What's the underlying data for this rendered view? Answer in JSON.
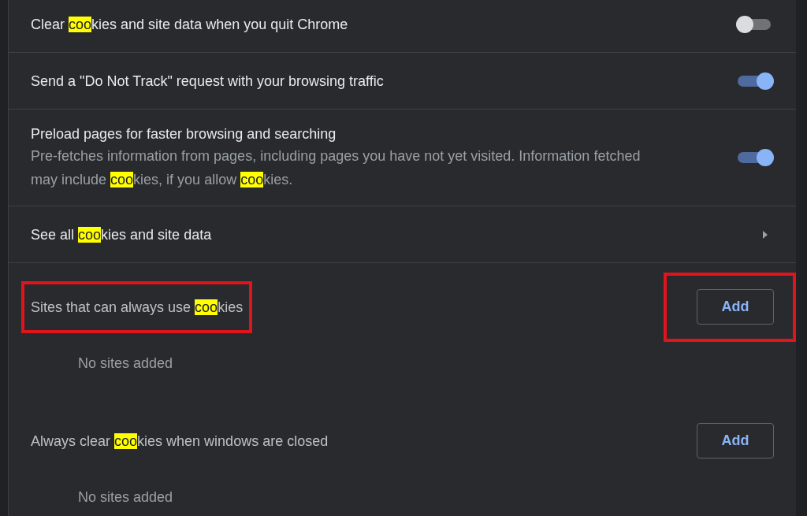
{
  "settings": [
    {
      "kind": "toggle",
      "on": false,
      "title": [
        {
          "text": "Clear ",
          "highlight": false
        },
        {
          "text": "coo",
          "highlight": true
        },
        {
          "text": "kies and site data when you quit Chrome",
          "highlight": false
        }
      ]
    },
    {
      "kind": "toggle",
      "on": true,
      "title": [
        {
          "text": "Send a \"Do Not Track\" request with your browsing traffic",
          "highlight": false
        }
      ]
    },
    {
      "kind": "toggle",
      "on": true,
      "title": [
        {
          "text": "Preload pages for faster browsing and searching",
          "highlight": false
        }
      ],
      "description": [
        {
          "text": "Pre-fetches information from pages, including pages you have not yet visited. Information fetched may include ",
          "highlight": false
        },
        {
          "text": "coo",
          "highlight": true
        },
        {
          "text": "kies, if you allow ",
          "highlight": false
        },
        {
          "text": "coo",
          "highlight": true
        },
        {
          "text": "kies.",
          "highlight": false
        }
      ]
    },
    {
      "kind": "link",
      "title": [
        {
          "text": "See all ",
          "highlight": false
        },
        {
          "text": "coo",
          "highlight": true
        },
        {
          "text": "kies and site data",
          "highlight": false
        }
      ]
    }
  ],
  "site_lists": [
    {
      "annotated": true,
      "title": [
        {
          "text": "Sites that can always use ",
          "highlight": false
        },
        {
          "text": "coo",
          "highlight": true
        },
        {
          "text": "kies",
          "highlight": false
        }
      ],
      "button": "Add",
      "empty_text": "No sites added"
    },
    {
      "annotated": false,
      "title": [
        {
          "text": "Always clear ",
          "highlight": false
        },
        {
          "text": "coo",
          "highlight": true
        },
        {
          "text": "kies when windows are closed",
          "highlight": false
        }
      ],
      "button": "Add",
      "empty_text": "No sites added"
    }
  ]
}
